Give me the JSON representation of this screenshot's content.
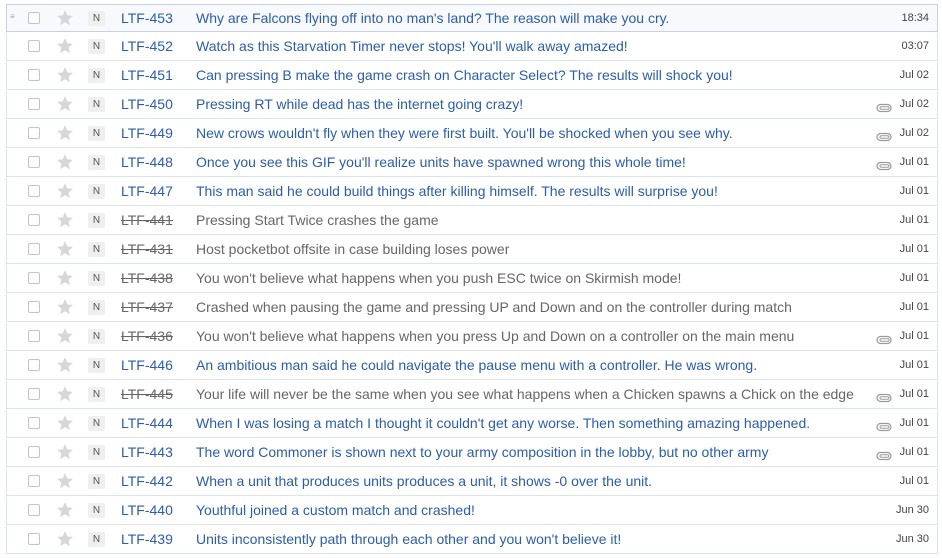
{
  "colors": {
    "link": "#2a5db0",
    "resolved_text": "#666666",
    "star": "#d7d7d7",
    "row_border": "#dde3ea"
  },
  "issues": [
    {
      "badge": "N",
      "key": "LTF-453",
      "summary": "Why are Falcons flying off into no man's land? The reason will make you cry.",
      "date": "18:34",
      "resolved": false,
      "attachment": false
    },
    {
      "badge": "N",
      "key": "LTF-452",
      "summary": "Watch as this Starvation Timer never stops! You'll walk away amazed!",
      "date": "03:07",
      "resolved": false,
      "attachment": false
    },
    {
      "badge": "N",
      "key": "LTF-451",
      "summary": "Can pressing B make the game crash on Character Select? The results will shock you!",
      "date": "Jul 02",
      "resolved": false,
      "attachment": false
    },
    {
      "badge": "N",
      "key": "LTF-450",
      "summary": "Pressing RT while dead has the internet going crazy!",
      "date": "Jul 02",
      "resolved": false,
      "attachment": true
    },
    {
      "badge": "N",
      "key": "LTF-449",
      "summary": "New crows wouldn't fly when they were first built. You'll be shocked when you see why.",
      "date": "Jul 02",
      "resolved": false,
      "attachment": true
    },
    {
      "badge": "N",
      "key": "LTF-448",
      "summary": "Once you see this GIF you'll realize units have spawned wrong this whole time!",
      "date": "Jul 01",
      "resolved": false,
      "attachment": true
    },
    {
      "badge": "N",
      "key": "LTF-447",
      "summary": "This man said he could build things after killing himself. The results will surprise you!",
      "date": "Jul 01",
      "resolved": false,
      "attachment": false
    },
    {
      "badge": "N",
      "key": "LTF-441",
      "summary": "Pressing Start Twice crashes the game",
      "date": "Jul 01",
      "resolved": true,
      "attachment": false
    },
    {
      "badge": "N",
      "key": "LTF-431",
      "summary": "Host pocketbot offsite in case building loses power",
      "date": "Jul 01",
      "resolved": true,
      "attachment": false
    },
    {
      "badge": "N",
      "key": "LTF-438",
      "summary": "You won't believe what happens when you push ESC twice on Skirmish mode!",
      "date": "Jul 01",
      "resolved": true,
      "attachment": false
    },
    {
      "badge": "N",
      "key": "LTF-437",
      "summary": "Crashed when pausing the game and pressing UP and Down and on the controller during match",
      "date": "Jul 01",
      "resolved": true,
      "attachment": false
    },
    {
      "badge": "N",
      "key": "LTF-436",
      "summary": "You won't believe what happens when you press Up and Down on a controller on the main menu",
      "date": "Jul 01",
      "resolved": true,
      "attachment": true
    },
    {
      "badge": "N",
      "key": "LTF-446",
      "summary": "An ambitious man said he could navigate the pause menu with a controller. He was wrong.",
      "date": "Jul 01",
      "resolved": false,
      "attachment": false
    },
    {
      "badge": "N",
      "key": "LTF-445",
      "summary": "Your life will never be the same when you see what happens when a Chicken spawns a Chick on the edge",
      "date": "Jul 01",
      "resolved": true,
      "attachment": true
    },
    {
      "badge": "N",
      "key": "LTF-444",
      "summary": "When I was losing a match I thought it couldn't get any worse. Then something amazing happened.",
      "date": "Jul 01",
      "resolved": false,
      "attachment": true
    },
    {
      "badge": "N",
      "key": "LTF-443",
      "summary": "The word Commoner is shown next to your army composition in the lobby, but no other army",
      "date": "Jul 01",
      "resolved": false,
      "attachment": true
    },
    {
      "badge": "N",
      "key": "LTF-442",
      "summary": "When a unit that produces units produces a unit, it shows -0 over the unit.",
      "date": "Jul 01",
      "resolved": false,
      "attachment": false
    },
    {
      "badge": "N",
      "key": "LTF-440",
      "summary": "Youthful joined a custom match and crashed!",
      "date": "Jun 30",
      "resolved": false,
      "attachment": false
    },
    {
      "badge": "N",
      "key": "LTF-439",
      "summary": "Units inconsistently path through each other and you won't believe it!",
      "date": "Jun 30",
      "resolved": false,
      "attachment": false
    }
  ]
}
